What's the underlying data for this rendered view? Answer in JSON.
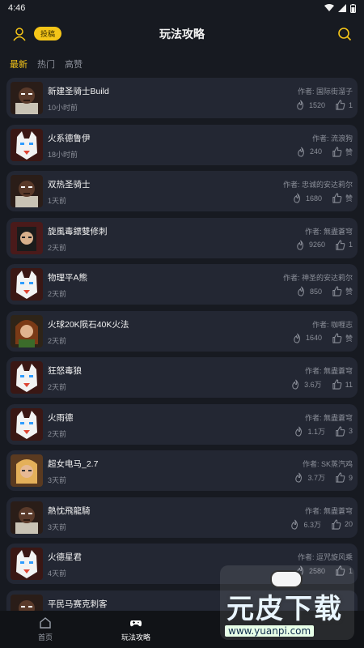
{
  "status": {
    "time": "4:46"
  },
  "header": {
    "title": "玩法攻略",
    "post_label": "投稿"
  },
  "tabs": [
    {
      "label": "最新",
      "active": true
    },
    {
      "label": "热门",
      "active": false
    },
    {
      "label": "高赞",
      "active": false
    }
  ],
  "items": [
    {
      "title": "新建圣骑士Build",
      "time": "10小时前",
      "author": "作者: 国际街溜子",
      "heat": "1520",
      "likes": "1",
      "avatar": "dark"
    },
    {
      "title": "火系德鲁伊",
      "time": "18小时前",
      "author": "作者: 流浪狗",
      "heat": "240",
      "likes": "赞",
      "avatar": "wolf"
    },
    {
      "title": "双热圣骑士",
      "time": "1天前",
      "author": "作者: 忠诚的安达莉尔",
      "heat": "1680",
      "likes": "赞",
      "avatar": "dark"
    },
    {
      "title": "旋風毒鏢雙修刺",
      "time": "2天前",
      "author": "作者: 無盡蒼穹",
      "heat": "9260",
      "likes": "1",
      "avatar": "assassin"
    },
    {
      "title": "物理平A熊",
      "time": "2天前",
      "author": "作者: 神圣的安达莉尔",
      "heat": "850",
      "likes": "赞",
      "avatar": "wolf"
    },
    {
      "title": "火球20K陨石40K火法",
      "time": "2天前",
      "author": "作者: 咖喱志",
      "heat": "1640",
      "likes": "赞",
      "avatar": "sorc"
    },
    {
      "title": "狂怒毒狼",
      "time": "2天前",
      "author": "作者: 無盡蒼穹",
      "heat": "3.6万",
      "likes": "11",
      "avatar": "wolf"
    },
    {
      "title": "火雨德",
      "time": "2天前",
      "author": "作者: 無盡蒼穹",
      "heat": "1.1万",
      "likes": "3",
      "avatar": "wolf"
    },
    {
      "title": "超女电马_2.7",
      "time": "3天前",
      "author": "作者: SK蒸汽鸡",
      "heat": "3.7万",
      "likes": "9",
      "avatar": "amazon"
    },
    {
      "title": "熱忱飛龍騎",
      "time": "3天前",
      "author": "作者: 無盡蒼穹",
      "heat": "6.3万",
      "likes": "20",
      "avatar": "dark"
    },
    {
      "title": "火德星君",
      "time": "4天前",
      "author": "作者: 逗咒旋风乘",
      "heat": "2580",
      "likes": "1",
      "avatar": "wolf"
    },
    {
      "title": "平民马赛克刺客",
      "time": "",
      "author": "",
      "heat": "",
      "likes": "",
      "avatar": "dark"
    }
  ],
  "nav": [
    {
      "label": "首页",
      "icon": "home-icon",
      "active": false
    },
    {
      "label": "玩法攻略",
      "icon": "gamepad-icon",
      "active": true
    }
  ],
  "watermark": {
    "text": "元皮下载",
    "url": "www.yuanpi.com"
  },
  "colors": {
    "accent": "#f5c518",
    "bg": "#171a21",
    "card": "#232733"
  }
}
